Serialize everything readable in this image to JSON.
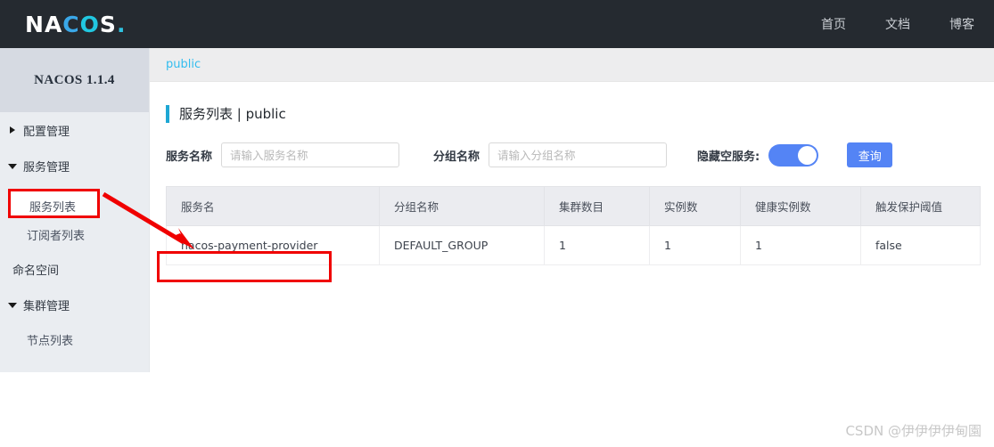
{
  "topbar": {
    "logo_text": "NACOS.",
    "logo_parts": [
      "N",
      "A",
      "C",
      "O",
      "S",
      "."
    ],
    "nav": [
      {
        "label": "首页",
        "name": "nav-home"
      },
      {
        "label": "文档",
        "name": "nav-docs"
      },
      {
        "label": "博客",
        "name": "nav-blog"
      }
    ]
  },
  "sidebar": {
    "version_title": "NACOS 1.1.4",
    "items": [
      {
        "label": "配置管理",
        "type": "group",
        "expanded": false
      },
      {
        "label": "服务管理",
        "type": "group",
        "expanded": true
      },
      {
        "label": "服务列表",
        "type": "sub",
        "active": true
      },
      {
        "label": "订阅者列表",
        "type": "sub",
        "active": false
      },
      {
        "label": "命名空间",
        "type": "plain"
      },
      {
        "label": "集群管理",
        "type": "group",
        "expanded": true
      },
      {
        "label": "节点列表",
        "type": "sub",
        "active": false
      }
    ]
  },
  "namespace_tab": {
    "label": "public"
  },
  "page": {
    "title": "服务列表 | public",
    "accent_color": "#1ea7d4"
  },
  "filter": {
    "service_name_label": "服务名称",
    "service_name_value": "",
    "service_name_placeholder": "请输入服务名称",
    "group_name_label": "分组名称",
    "group_name_value": "",
    "group_name_placeholder": "请输入分组名称",
    "hide_empty_label": "隐藏空服务:",
    "hide_empty_on": true,
    "query_label": "查询",
    "accent_color": "#5484f5"
  },
  "table": {
    "columns": [
      "服务名",
      "分组名称",
      "集群数目",
      "实例数",
      "健康实例数",
      "触发保护阈值"
    ],
    "rows": [
      [
        "nacos-payment-provider",
        "DEFAULT_GROUP",
        "1",
        "1",
        "1",
        "false"
      ]
    ]
  },
  "annotations": {
    "color": "#f00000",
    "sidebar_highlight_label": "服务列表"
  },
  "watermark": {
    "text": "CSDN @伊伊伊伊甸園"
  }
}
